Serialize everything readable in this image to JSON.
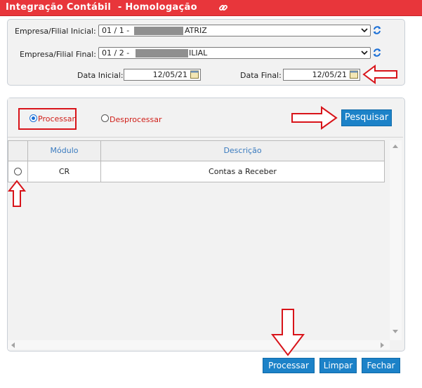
{
  "window": {
    "title": "Integração Contábil  - Homologação"
  },
  "filters": {
    "empresa_inicial_label": "Empresa/Filial Inicial:",
    "empresa_inicial_prefix": "01 / 1 - ",
    "empresa_inicial_suffix": "ATRIZ",
    "empresa_final_label": "Empresa/Filial Final:",
    "empresa_final_prefix": "01 / 2 - ",
    "empresa_final_suffix": "ILIAL",
    "data_inicial_label": "Data Inicial:",
    "data_inicial_value": "12/05/21",
    "data_final_label": "Data Final:",
    "data_final_value": "12/05/21"
  },
  "mode": {
    "options": [
      "Processar",
      "Desprocessar"
    ],
    "selected": "Processar",
    "search_button": "Pesquisar"
  },
  "table": {
    "columns": [
      "Módulo",
      "Descrição"
    ],
    "rows": [
      {
        "modulo": "CR",
        "descricao": "Contas a Receber"
      }
    ]
  },
  "actions": {
    "process": "Processar",
    "clear": "Limpar",
    "close": "Fechar"
  },
  "colors": {
    "title_bar": "#e8363b",
    "button": "#1c82c8",
    "annotation_red": "#d8141a",
    "radio_label": "#d0201a"
  },
  "icons": [
    "link-icon",
    "refresh-icon",
    "calendar-icon",
    "chevron-down-icon"
  ]
}
